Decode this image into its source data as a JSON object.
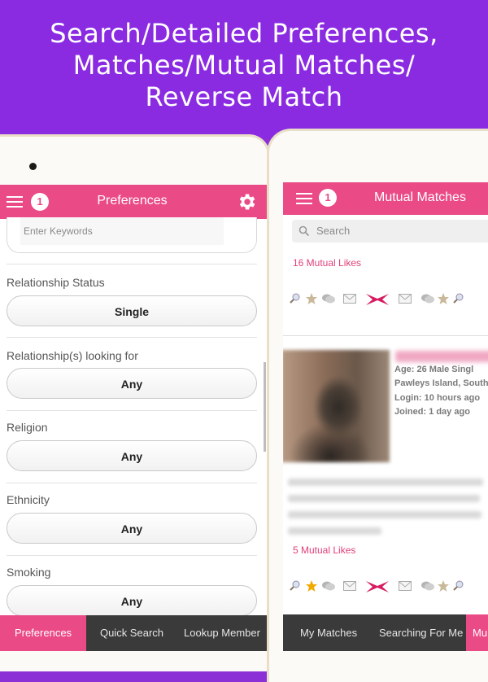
{
  "banner": {
    "line1": "Search/Detailed Preferences,",
    "line2": "Matches/Mutual Matches/",
    "line3": "Reverse Match"
  },
  "left_screen": {
    "title": "Preferences",
    "notification_count": "1",
    "keyword_placeholder": "Enter Keywords",
    "fields": [
      {
        "label": "Relationship Status",
        "value": "Single"
      },
      {
        "label": "Relationship(s) looking for",
        "value": "Any"
      },
      {
        "label": "Religion",
        "value": "Any"
      },
      {
        "label": "Ethnicity",
        "value": "Any"
      },
      {
        "label": "Smoking",
        "value": "Any"
      }
    ],
    "bottom_tabs": [
      "Preferences",
      "Quick Search",
      "Lookup Member"
    ],
    "active_tab": "Preferences"
  },
  "right_screen": {
    "title": "Mutual Matches",
    "notification_count": "1",
    "search_placeholder": "Search",
    "likes_1": "16 Mutual Likes",
    "likes_2": "5 Mutual Likes",
    "profile": {
      "age_line": "Age: 26   Male   Singl",
      "location": "Pawleys Island, South",
      "login": "Login: 10 hours ago",
      "joined": "Joined: 1 day ago"
    },
    "bottom_tabs": [
      "My Matches",
      "Searching For Me",
      "Mu"
    ],
    "active_tab": "Mu"
  },
  "icons": [
    "search-icon",
    "star-icon",
    "chat-icon",
    "mail-icon",
    "match-icon",
    "gear-icon",
    "menu-icon"
  ],
  "colors": {
    "accent": "#ea4a86",
    "banner": "#8a2be2",
    "bottom_bar": "#3a3a3a"
  }
}
